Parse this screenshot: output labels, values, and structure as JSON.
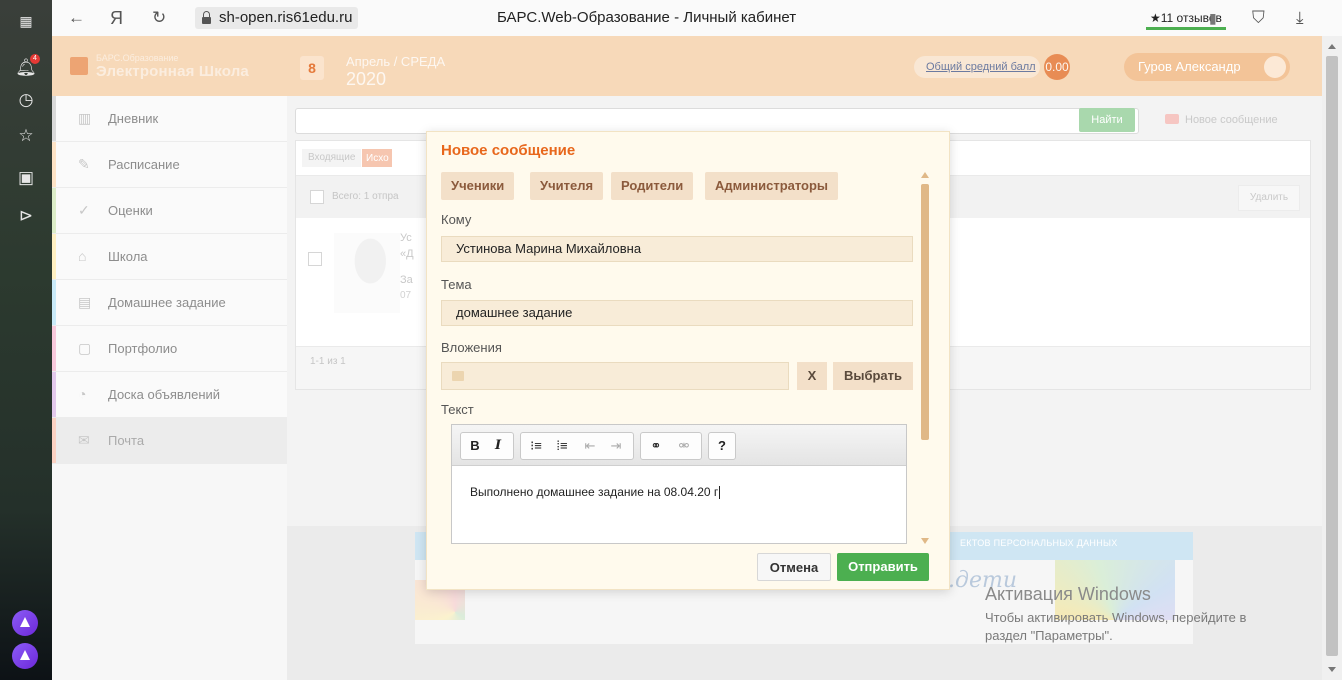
{
  "browser": {
    "url_domain": "sh-open.ris61edu.ru",
    "page_title": "БАРС.Web-Образование - Личный кабинет",
    "reviews": "★11 отзывов",
    "notification_count": "4"
  },
  "header": {
    "logo_line1": "БАРС.Образование",
    "logo_line2": "Электронная Школа",
    "day": "8",
    "date_line1": "Апрель / СРЕДА",
    "date_line2": "2020",
    "avg_label": "Общий средний балл",
    "avg_score": "0.00",
    "user_name": "Гуров Александр"
  },
  "sidebar": {
    "items": [
      {
        "label": "Дневник",
        "icon": "diary-icon"
      },
      {
        "label": "Расписание",
        "icon": "schedule-icon"
      },
      {
        "label": "Оценки",
        "icon": "grades-icon"
      },
      {
        "label": "Школа",
        "icon": "school-icon"
      },
      {
        "label": "Домашнее задание",
        "icon": "homework-icon"
      },
      {
        "label": "Портфолио",
        "icon": "portfolio-icon"
      },
      {
        "label": "Доска объявлений",
        "icon": "board-icon"
      },
      {
        "label": "Почта",
        "icon": "mail-icon"
      }
    ],
    "accent_colors": [
      "#9e9e9e",
      "#ff9800",
      "#8bc34a",
      "#ffc107",
      "#03a9f4",
      "#e91e63",
      "#9c27b0",
      "#ff5722"
    ]
  },
  "main": {
    "find_label": "Найти",
    "new_message_label": "Новое сообщение",
    "tab_inbox": "Входящие",
    "tab_outbox": "Исхо",
    "total_text": "Всего: 1 отпра",
    "delete_label": "Удалить",
    "row_line1": "Ус",
    "row_line2": "«Д",
    "row_line3": "За",
    "row_line4": "07",
    "pager_text": "1-1 из 1",
    "banner_text": "ЕКТОВ ПЕРСОНАЛЬНЫХ ДАННЫХ",
    "banner_deti": "е.дети"
  },
  "modal": {
    "title": "Новое сообщение",
    "recipient_tabs": [
      "Ученики",
      "Учителя",
      "Родители",
      "Администраторы"
    ],
    "to_label": "Кому",
    "to_value": "Устинова Марина Михайловна",
    "subject_label": "Тема",
    "subject_value": "домашнее задание",
    "attachments_label": "Вложения",
    "clear_label": "X",
    "choose_label": "Выбрать",
    "text_label": "Текст",
    "editor_tools": {
      "bold": "B",
      "italic": "I",
      "help": "?"
    },
    "body_text": "Выполнено домашнее задание на 08.04.20 г",
    "cancel_label": "Отмена",
    "send_label": "Отправить"
  },
  "windows": {
    "activation_title": "Активация Windows",
    "activation_line1": "Чтобы активировать Windows, перейдите в",
    "activation_line2": "раздел \"Параметры\"."
  },
  "colors": {
    "accent_orange": "#e8671c",
    "send_green": "#4caf50",
    "header_peach": "#f7d9b9"
  }
}
